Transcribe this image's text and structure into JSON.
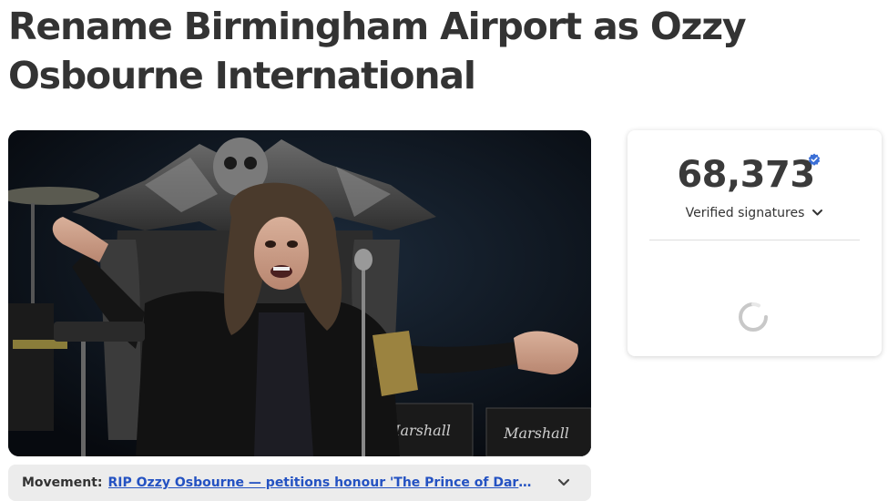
{
  "petition": {
    "title": "Rename Birmingham Airport as Ozzy Osbourne International"
  },
  "hero_image": {
    "alt": "Ozzy Osbourne seated on a bat-winged throne, arms outstretched, in front of Marshall amplifiers",
    "amp_brand": "Marshall"
  },
  "movement": {
    "label": "Movement:",
    "link_text": "RIP Ozzy Osbourne — petitions honour 'The Prince of Darkness'"
  },
  "signatures": {
    "count": "68,373",
    "label": "Verified signatures"
  },
  "colors": {
    "link": "#2452c2",
    "verified_badge": "#3b6fd6",
    "movement_bg": "#ececec"
  }
}
